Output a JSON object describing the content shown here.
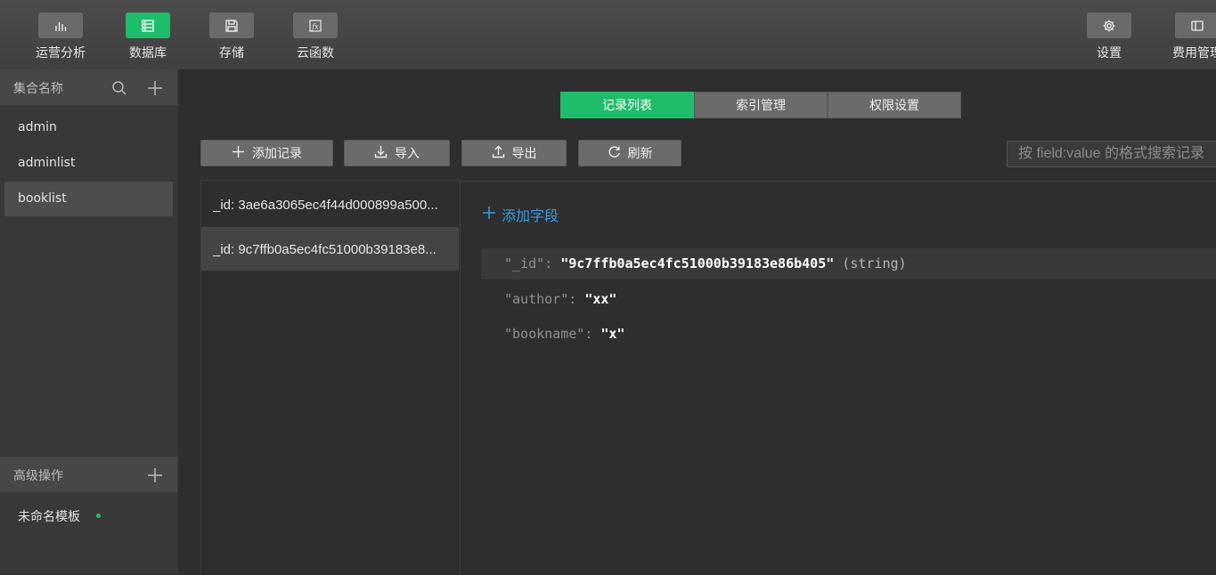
{
  "toolbar": {
    "left_items": [
      {
        "label": "运营分析",
        "icon": "bar-chart-icon"
      },
      {
        "label": "数据库",
        "icon": "database-icon",
        "active": true
      },
      {
        "label": "存储",
        "icon": "save-icon"
      },
      {
        "label": "云函数",
        "icon": "function-icon"
      }
    ],
    "right_items": [
      {
        "label": "设置",
        "icon": "gear-icon"
      },
      {
        "label": "费用管理",
        "icon": "wallet-icon"
      }
    ]
  },
  "sidebar": {
    "collections_header": "集合名称",
    "collections": [
      {
        "name": "admin"
      },
      {
        "name": "adminlist"
      },
      {
        "name": "booklist",
        "selected": true
      }
    ],
    "advanced_header": "高级操作",
    "template_name": "未命名模板"
  },
  "tabs": [
    {
      "label": "记录列表",
      "active": true
    },
    {
      "label": "索引管理"
    },
    {
      "label": "权限设置"
    }
  ],
  "actions": {
    "add_record": "添加记录",
    "import": "导入",
    "export": "导出",
    "refresh": "刷新"
  },
  "search": {
    "placeholder": "按 field:value 的格式搜索记录"
  },
  "records": [
    {
      "label": "_id: 3ae6a3065ec4f44d000899a500..."
    },
    {
      "label": "_id: 9c7ffb0a5ec4fc51000b39183e8...",
      "selected": true
    }
  ],
  "detail": {
    "add_field": "添加字段",
    "fields": [
      {
        "key": "\"_id\"",
        "value": "\"9c7ffb0a5ec4fc51000b39183e86b405\"",
        "type": "(string)"
      },
      {
        "key": "\"author\"",
        "value": "\"xx\"",
        "type": ""
      },
      {
        "key": "\"bookname\"",
        "value": "\"x\"",
        "type": ""
      }
    ]
  },
  "colors": {
    "accent": "#1fbd6a",
    "link": "#3d9be0",
    "background": "#2e2e2e"
  }
}
